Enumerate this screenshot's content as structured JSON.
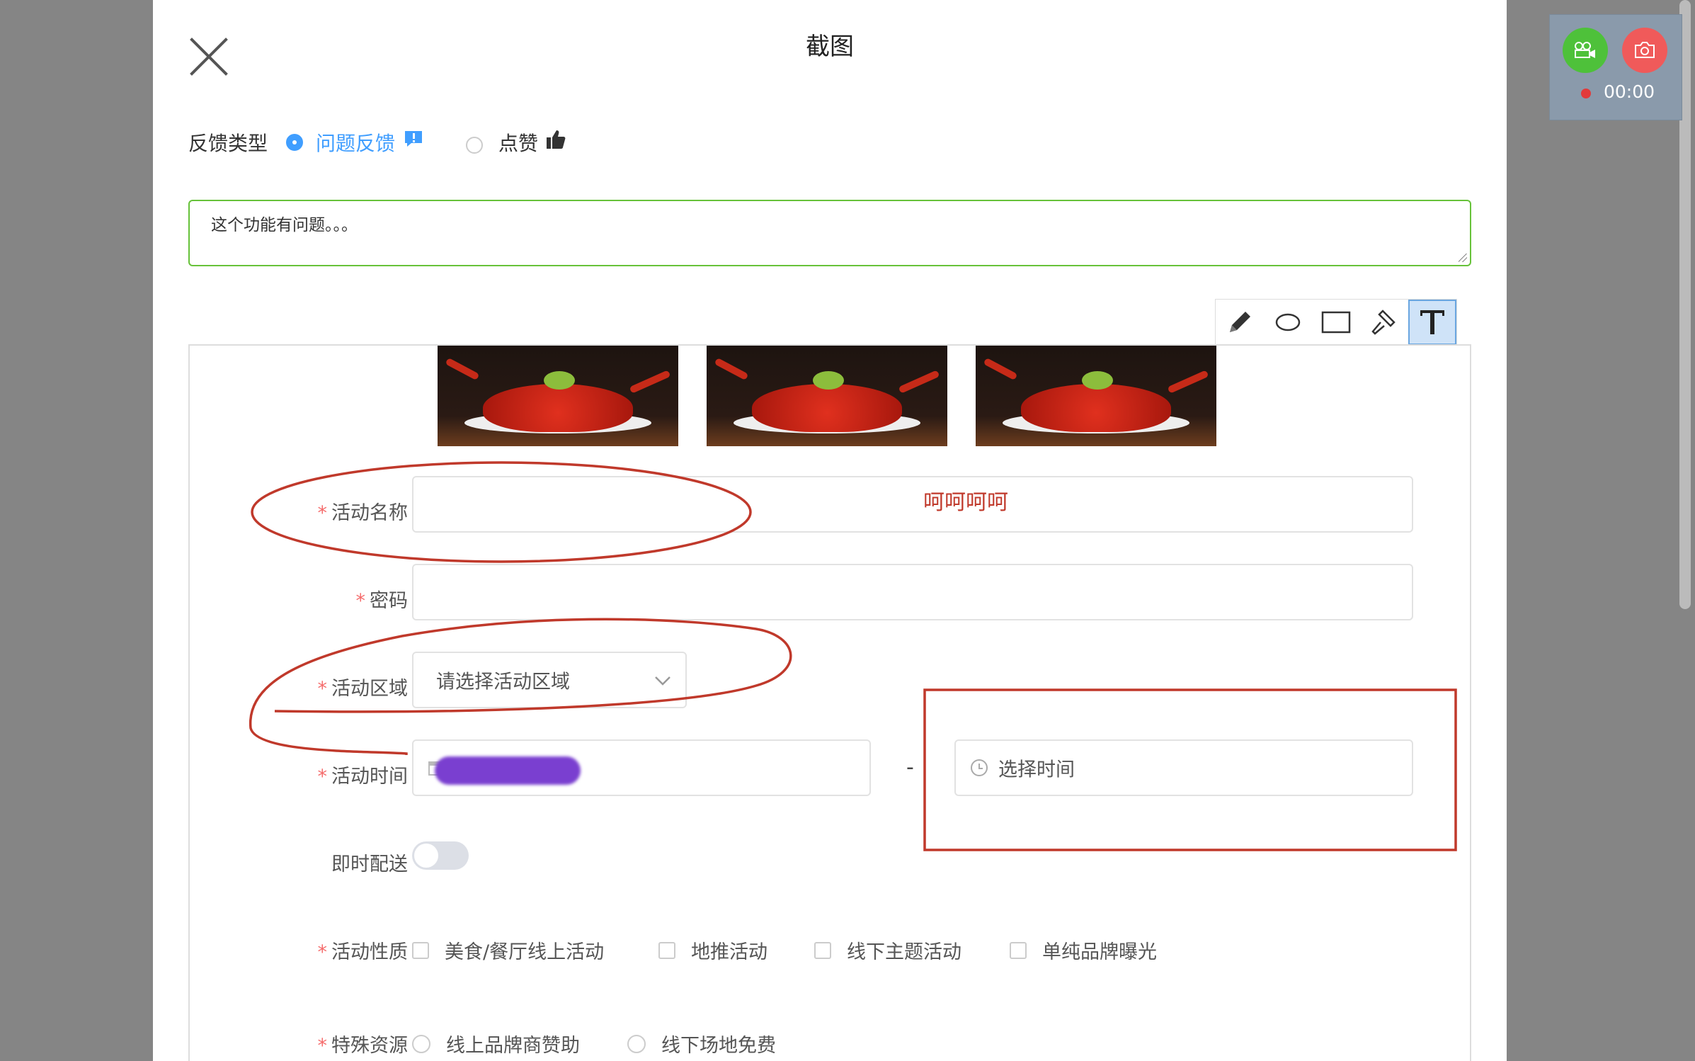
{
  "dialog": {
    "title": "截图"
  },
  "feedback": {
    "label": "反馈类型",
    "options": [
      {
        "label": "问题反馈",
        "selected": true
      },
      {
        "label": "点赞",
        "selected": false
      }
    ]
  },
  "note": {
    "value": "这个功能有问题。。。"
  },
  "tools": [
    "pencil-icon",
    "ellipse-icon",
    "rectangle-icon",
    "hammer-icon",
    "text-icon"
  ],
  "annotation_text": "呵呵呵呵",
  "form": {
    "name": {
      "label": "活动名称",
      "required": true,
      "value": ""
    },
    "password": {
      "label": "密码",
      "required": true,
      "value": ""
    },
    "region": {
      "label": "活动区域",
      "required": true,
      "placeholder": "请选择活动区域"
    },
    "time": {
      "label": "活动时间",
      "required": true,
      "separator": "-",
      "time_placeholder": "选择时间"
    },
    "delivery": {
      "label": "即时配送",
      "on": false
    },
    "nature": {
      "label": "活动性质",
      "required": true,
      "options": [
        "美食/餐厅线上活动",
        "地推活动",
        "线下主题活动",
        "单纯品牌曝光"
      ]
    },
    "resources": {
      "label": "特殊资源",
      "required": true,
      "options": [
        "线上品牌商赞助",
        "线下场地免费"
      ]
    }
  },
  "recorder": {
    "time": "00:00"
  },
  "colors": {
    "accent": "#409eff",
    "note_border": "#67c23a",
    "annotation": "#c0392b",
    "record_green": "#4ec13a",
    "record_red": "#f05a5a"
  }
}
